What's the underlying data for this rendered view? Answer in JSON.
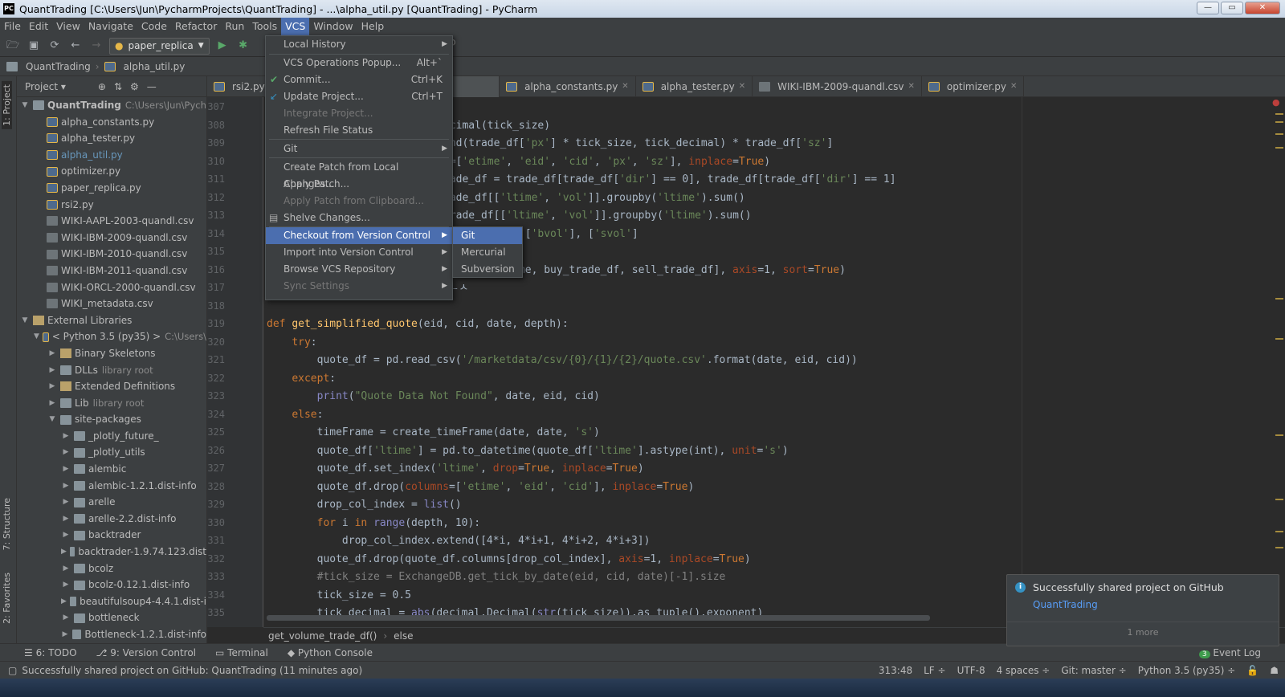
{
  "window": {
    "title": "QuantTrading [C:\\Users\\Jun\\PycharmProjects\\QuantTrading] - ...\\alpha_util.py [QuantTrading] - PyCharm",
    "app_badge": "PC",
    "minimize": "—",
    "maximize": "▭",
    "close": "✕"
  },
  "menu": [
    "File",
    "Edit",
    "View",
    "Navigate",
    "Code",
    "Refactor",
    "Run",
    "Tools",
    "VCS",
    "Window",
    "Help"
  ],
  "toolbar": {
    "run_config": "paper_replica"
  },
  "nav": {
    "project": "QuantTrading",
    "file": "alpha_util.py"
  },
  "leftstrip": {
    "project": "1: Project",
    "structure": "7: Structure",
    "favorites": "2: Favorites"
  },
  "project_panel": {
    "header": "Project",
    "tree": [
      {
        "label": "QuantTrading",
        "extra": "C:\\Users\\Jun\\Pych",
        "depth": 0,
        "icon": "dir",
        "twisty": "▼",
        "bold": true
      },
      {
        "label": "alpha_constants.py",
        "depth": 1,
        "icon": "py"
      },
      {
        "label": "alpha_tester.py",
        "depth": 1,
        "icon": "py"
      },
      {
        "label": "alpha_util.py",
        "depth": 1,
        "icon": "py",
        "selected": true
      },
      {
        "label": "optimizer.py",
        "depth": 1,
        "icon": "py"
      },
      {
        "label": "paper_replica.py",
        "depth": 1,
        "icon": "py"
      },
      {
        "label": "rsi2.py",
        "depth": 1,
        "icon": "py"
      },
      {
        "label": "WIKI-AAPL-2003-quandl.csv",
        "depth": 1,
        "icon": "csv"
      },
      {
        "label": "WIKI-IBM-2009-quandl.csv",
        "depth": 1,
        "icon": "csv"
      },
      {
        "label": "WIKI-IBM-2010-quandl.csv",
        "depth": 1,
        "icon": "csv"
      },
      {
        "label": "WIKI-IBM-2011-quandl.csv",
        "depth": 1,
        "icon": "csv"
      },
      {
        "label": "WIKI-ORCL-2000-quandl.csv",
        "depth": 1,
        "icon": "csv"
      },
      {
        "label": "WIKI_metadata.csv",
        "depth": 1,
        "icon": "csv"
      },
      {
        "label": "External Libraries",
        "depth": 0,
        "icon": "lib",
        "twisty": "▼"
      },
      {
        "label": "< Python 3.5 (py35) >",
        "extra": "C:\\Users\\",
        "depth": 1,
        "icon": "py",
        "twisty": "▼"
      },
      {
        "label": "Binary Skeletons",
        "depth": 2,
        "icon": "lib",
        "twisty": "▶"
      },
      {
        "label": "DLLs",
        "extra": "library root",
        "depth": 2,
        "icon": "dir",
        "twisty": "▶"
      },
      {
        "label": "Extended Definitions",
        "depth": 2,
        "icon": "lib",
        "twisty": "▶"
      },
      {
        "label": "Lib",
        "extra": "library root",
        "depth": 2,
        "icon": "dir",
        "twisty": "▶"
      },
      {
        "label": "site-packages",
        "depth": 2,
        "icon": "dir",
        "twisty": "▼"
      },
      {
        "label": "_plotly_future_",
        "depth": 3,
        "icon": "dir",
        "twisty": "▶"
      },
      {
        "label": "_plotly_utils",
        "depth": 3,
        "icon": "dir",
        "twisty": "▶"
      },
      {
        "label": "alembic",
        "depth": 3,
        "icon": "dir",
        "twisty": "▶"
      },
      {
        "label": "alembic-1.2.1.dist-info",
        "depth": 3,
        "icon": "dir",
        "twisty": "▶"
      },
      {
        "label": "arelle",
        "depth": 3,
        "icon": "dir",
        "twisty": "▶"
      },
      {
        "label": "arelle-2.2.dist-info",
        "depth": 3,
        "icon": "dir",
        "twisty": "▶"
      },
      {
        "label": "backtrader",
        "depth": 3,
        "icon": "dir",
        "twisty": "▶"
      },
      {
        "label": "backtrader-1.9.74.123.dist",
        "depth": 3,
        "icon": "dir",
        "twisty": "▶"
      },
      {
        "label": "bcolz",
        "depth": 3,
        "icon": "dir",
        "twisty": "▶"
      },
      {
        "label": "bcolz-0.12.1.dist-info",
        "depth": 3,
        "icon": "dir",
        "twisty": "▶"
      },
      {
        "label": "beautifulsoup4-4.4.1.dist-i",
        "depth": 3,
        "icon": "dir",
        "twisty": "▶"
      },
      {
        "label": "bottleneck",
        "depth": 3,
        "icon": "dir",
        "twisty": "▶"
      },
      {
        "label": "Bottleneck-1.2.1.dist-info",
        "depth": 3,
        "icon": "dir",
        "twisty": "▶"
      }
    ]
  },
  "tabs": [
    {
      "label": "rsi2.py"
    },
    {
      "label": "alpha_constants.py"
    },
    {
      "label": "alpha_tester.py"
    },
    {
      "label": "WIKI-IBM-2009-quandl.csv"
    },
    {
      "label": "optimizer.py"
    }
  ],
  "line_numbers": [
    "307",
    "308",
    "309",
    "310",
    "311",
    "312",
    "313",
    "314",
    "315",
    "316",
    "317",
    "318",
    "319",
    "320",
    "321",
    "322",
    "323",
    "324",
    "325",
    "326",
    "327",
    "328",
    "329",
    "330",
    "331",
    "332",
    "333",
    "334",
    "335"
  ],
  "code_lines": [
    "",
    "ecimal(tick_size)",
    "und(trade_df['px'] * tick_size, tick_decimal) * trade_df['sz']",
    "s=['etime', 'eid', 'cid', 'px', 'sz'], inplace=True)",
    "rade_df = trade_df[trade_df['dir'] == 0], trade_df[trade_df['dir'] == 1]",
    "rade_df[['ltime', 'vol']].groupby('ltime').sum()",
    "trade_df[['ltime', 'vol']].groupby('ltime').sum()",
    "df.columns = ['bvol'], ['svol']",
    ", date, 's')",
    "cat([timeFrame, buy_trade_df, sell_trade_df], axis=1, sort=True)",
    "    return agg_trade_df # 씨ㄷㄴㅅ",
    "",
    "def get_simplified_quote(eid, cid, date, depth):",
    "    try:",
    "        quote_df = pd.read_csv('/marketdata/csv/{0}/{1}/{2}/quote.csv'.format(date, eid, cid))",
    "    except:",
    "        print(\"Quote Data Not Found\", date, eid, cid)",
    "    else:",
    "        timeFrame = create_timeFrame(date, date, 's')",
    "        quote_df['ltime'] = pd.to_datetime(quote_df['ltime'].astype(int), unit='s')",
    "        quote_df.set_index('ltime', drop=True, inplace=True)",
    "        quote_df.drop(columns=['etime', 'eid', 'cid'], inplace=True)",
    "        drop_col_index = list()",
    "        for i in range(depth, 10):",
    "            drop_col_index.extend([4*i, 4*i+1, 4*i+2, 4*i+3])",
    "        quote_df.drop(quote_df.columns[drop_col_index], axis=1, inplace=True)",
    "        #tick_size = ExchangeDB.get_tick_by_date(eid, cid, date)[-1].size",
    "        tick_size = 0.5",
    "        tick_decimal = abs(decimal.Decimal(str(tick_size)).as_tuple().exponent)"
  ],
  "breadcrumb": {
    "fn": "get_volume_trade_df()",
    "sep": "›",
    "block": "else"
  },
  "vcs_menu": {
    "local_history": "Local History",
    "ops_popup": "VCS Operations Popup...",
    "ops_popup_sc": "Alt+`",
    "commit": "Commit...",
    "commit_sc": "Ctrl+K",
    "update": "Update Project...",
    "update_sc": "Ctrl+T",
    "integrate": "Integrate Project...",
    "refresh": "Refresh File Status",
    "git": "Git",
    "create_patch": "Create Patch from Local Changes...",
    "apply_patch": "Apply Patch...",
    "apply_clip": "Apply Patch from Clipboard...",
    "shelve": "Shelve Changes...",
    "checkout": "Checkout from Version Control",
    "import": "Import into Version Control",
    "browse": "Browse VCS Repository",
    "sync": "Sync Settings"
  },
  "checkout_submenu": [
    "Git",
    "Mercurial",
    "Subversion"
  ],
  "notification": {
    "title": "Successfully shared project on GitHub",
    "link": "QuantTrading",
    "more": "1 more"
  },
  "toolwindows": [
    "6: TODO",
    "9: Version Control",
    "Terminal",
    "Python Console"
  ],
  "event_log": "Event Log",
  "event_count": "3",
  "status": {
    "message": "Successfully shared project on GitHub: QuantTrading (11 minutes ago)",
    "position": "313:48",
    "line_sep": "LF ÷",
    "encoding": "UTF-8",
    "indent": "4 spaces ÷",
    "git": "Git: master ÷",
    "interpreter": "Python 3.5 (py35) ÷"
  },
  "colors": {
    "accent": "#4b6eaf",
    "bg": "#2b2b2b",
    "panel": "#3c3f41",
    "keyword": "#cc7832",
    "string": "#6a8759",
    "number": "#6897bb",
    "link": "#589df6"
  }
}
